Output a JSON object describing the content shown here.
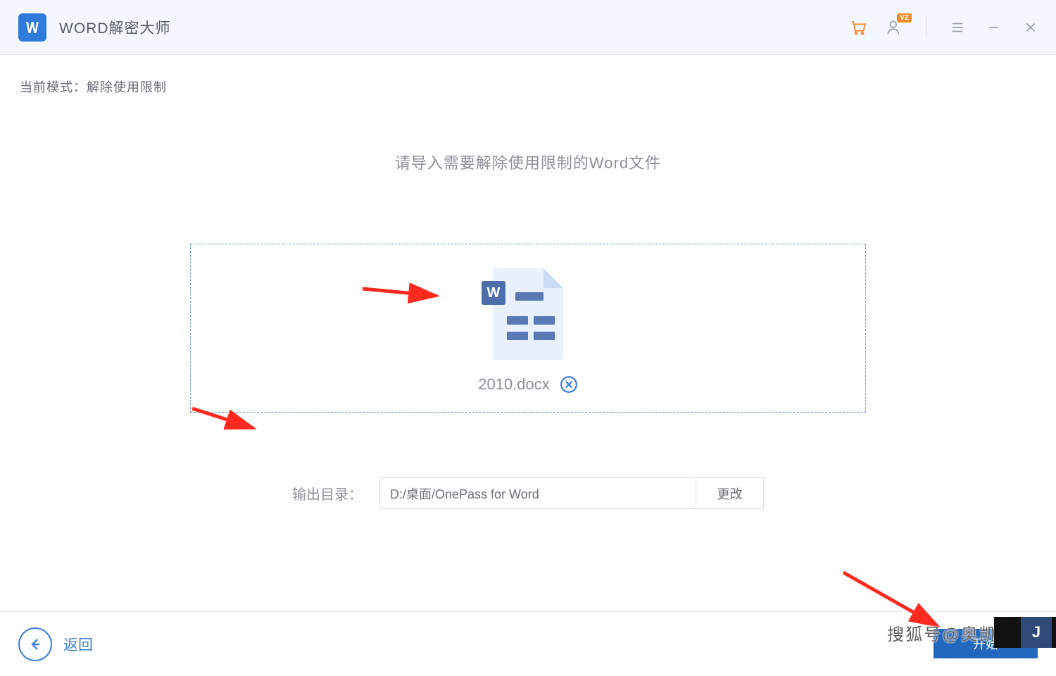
{
  "titlebar": {
    "app_name": "WORD解密大师",
    "user_badge": "VZ"
  },
  "mode": {
    "label": "当前模式：",
    "value": "解除使用限制"
  },
  "instruction": "请导入需要解除使用限制的Word文件",
  "file": {
    "name": "2010.docx",
    "badge_letter": "W"
  },
  "output": {
    "label": "输出目录：",
    "path": "D:/桌面/OnePass for Word",
    "change_label": "更改"
  },
  "bottom": {
    "back_label": "返回",
    "start_label": "开始"
  },
  "watermark": "搜狐号@奥凯丰o"
}
